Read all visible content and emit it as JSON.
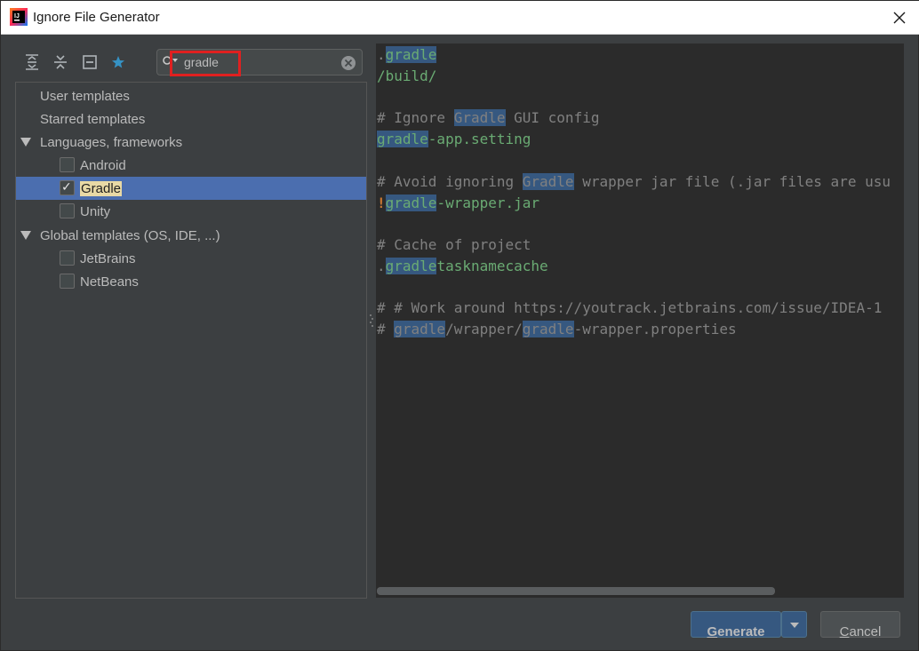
{
  "window": {
    "title": "Ignore File Generator"
  },
  "search": {
    "value": "gradle"
  },
  "tree": {
    "items": [
      {
        "label": "User templates"
      },
      {
        "label": "Starred templates"
      },
      {
        "label": "Languages, frameworks"
      },
      {
        "label": "Android",
        "checked": false
      },
      {
        "label": "Gradle",
        "checked": true
      },
      {
        "label": "Unity",
        "checked": false
      },
      {
        "label": "Global templates (OS, IDE, ...)"
      },
      {
        "label": "JetBrains",
        "checked": false
      },
      {
        "label": "NetBeans",
        "checked": false
      }
    ]
  },
  "editor": {
    "lines": [
      ".gradle",
      "/build/",
      "",
      "# Ignore Gradle GUI config",
      "gradle-app.setting",
      "",
      "# Avoid ignoring Gradle wrapper jar file (.jar files are usu",
      "!gradle-wrapper.jar",
      "",
      "# Cache of project",
      ".gradletasknamecache",
      "",
      "# # Work around https://youtrack.jetbrains.com/issue/IDEA-1",
      "# gradle/wrapper/gradle-wrapper.properties"
    ],
    "highlight_term": "gradle"
  },
  "buttons": {
    "generate_label": "Generate",
    "cancel_label": "Cancel"
  },
  "colors": {
    "selection": "#4b6eaf",
    "search_highlight_border": "#e02020",
    "editor_background": "#2b2b2b",
    "match_background": "#365880"
  }
}
